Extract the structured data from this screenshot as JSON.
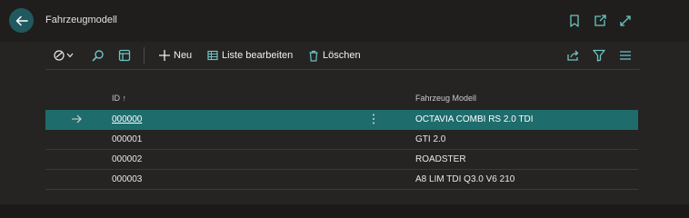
{
  "header": {
    "title": "Fahrzeugmodell",
    "back_icon": "arrow-left-icon",
    "icons": [
      "bookmark-icon",
      "open-new-window-icon",
      "expand-icon"
    ]
  },
  "toolbar": {
    "new_label": "Neu",
    "edit_list_label": "Liste bearbeiten",
    "delete_label": "Löschen",
    "left_icons": [
      "view-switcher-icon",
      "search-icon",
      "layout-icon"
    ],
    "right_icons": [
      "share-icon",
      "filter-icon",
      "list-menu-icon"
    ]
  },
  "table": {
    "columns": [
      "ID ↑",
      "Fahrzeug Modell"
    ],
    "rows": [
      {
        "id": "000000",
        "model": "OCTAVIA COMBI RS 2.0 TDI",
        "selected": true
      },
      {
        "id": "000001",
        "model": "GTI 2.0",
        "selected": false
      },
      {
        "id": "000002",
        "model": "ROADSTER",
        "selected": false
      },
      {
        "id": "000003",
        "model": "A8 LIM TDI Q3.0 V6 210",
        "selected": false
      }
    ]
  },
  "colors": {
    "background": "#1b1a19",
    "panel": "#252423",
    "accent": "#1e6c6c",
    "icon_accent": "#6cc4c4"
  }
}
